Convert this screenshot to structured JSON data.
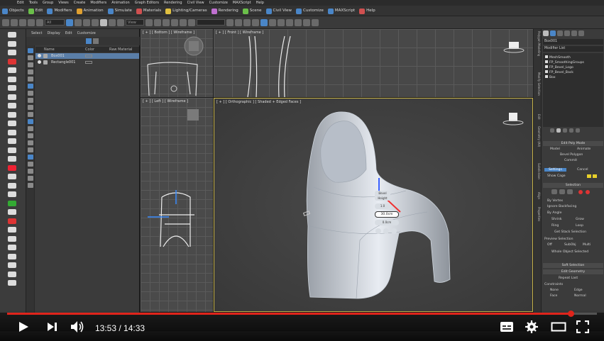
{
  "menubar": {
    "items": [
      "Edit",
      "Tools",
      "Group",
      "Views",
      "Create",
      "Modifiers",
      "Animation",
      "Graph Editors",
      "Rendering",
      "Civil View",
      "Customize",
      "MAXScript",
      "Help"
    ]
  },
  "ribbon": {
    "items": [
      {
        "label": "Objects",
        "color": "#4a86c8"
      },
      {
        "label": "Edit",
        "color": "#6bbf4a"
      },
      {
        "label": "Modifiers",
        "color": "#4a86c8"
      },
      {
        "label": "Animation",
        "color": "#e0a030"
      },
      {
        "label": "Simulate",
        "color": "#4a86c8"
      },
      {
        "label": "Materials",
        "color": "#d05050"
      },
      {
        "label": "Lighting/Cameras",
        "color": "#e0c040"
      },
      {
        "label": "Rendering",
        "color": "#c070d0"
      },
      {
        "label": "Scene",
        "color": "#6bbf4a"
      },
      {
        "label": "Civil View",
        "color": "#4a86c8"
      },
      {
        "label": "Customize",
        "color": "#4a86c8"
      },
      {
        "label": "MAXScript",
        "color": "#4a86c8"
      },
      {
        "label": "Help",
        "color": "#d05050"
      }
    ]
  },
  "toolbar": {
    "filter": "All",
    "view": "View"
  },
  "explorer": {
    "tabs": [
      "Select",
      "Display",
      "Edit",
      "Customize"
    ],
    "col_name": "Name",
    "col_color": "Color",
    "col_raw": "Raw Material",
    "rows": [
      {
        "name": "Box001",
        "selected": true
      },
      {
        "name": "Rectangle001",
        "selected": false
      }
    ]
  },
  "viewports": {
    "top": "[ + ] [ Bottom ] [ Wireframe ]",
    "front": "[ + ] [ Front ] [ Wireframe ]",
    "left": "[ + ] [ Left ] [ Wireframe ]",
    "persp": "[ + ] [ Orthographic ] [ Shaded + Edged Faces ]"
  },
  "caddy": {
    "title": "Bevel",
    "sub": "Height",
    "value1": "1.0",
    "value2": "30.0cm",
    "value3": "0.0cm"
  },
  "rightpanel": {
    "object": "Box001",
    "modifier_list": "Modifier List",
    "stack": [
      "MeshSmooth",
      "FP_SmoothingGroups",
      "FP_Bevel_Logo",
      "FP_Bevel_Back",
      "Box"
    ],
    "edit_poly_mode": "Edit Poly Mode",
    "model": "Model",
    "animate": "Animate",
    "bevel_polygon": "Bevel Polygon",
    "commit": "Commit",
    "settings": "Settings",
    "cancel": "Cancel",
    "show_cage": "Show Cage",
    "selection": "Selection",
    "by_vertex": "By Vertex",
    "ignore_backfacing": "Ignore Backfacing",
    "by_angle": "By Angle",
    "shrink": "Shrink",
    "grow": "Grow",
    "ring": "Ring",
    "loop": "Loop",
    "get_stack": "Get Stack Selection",
    "preview_sel": "Preview Selection",
    "off": "Off",
    "subobj": "SubObj",
    "multi": "Multi",
    "whole_obj": "Whole Object Selected",
    "soft_sel": "Soft Selection",
    "edit_geom": "Edit Geometry",
    "repeat_last": "Repeat Last",
    "constraints": "Constraints",
    "none": "None",
    "edge": "Edge",
    "face": "Face",
    "normal": "Normal"
  },
  "vtabs": [
    "Polygon Modeling",
    "Modify Selection",
    "Edit",
    "Geometry (All)",
    "Subdivision",
    "Align",
    "Properties"
  ],
  "player": {
    "current": "13:53",
    "total": "14:33",
    "progress": 0.955
  },
  "colors": {
    "accent": "#e0241b",
    "selected": "#5a7ea8"
  }
}
